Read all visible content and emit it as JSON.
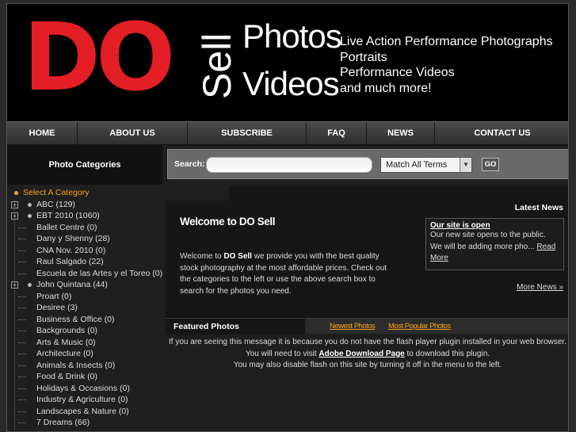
{
  "banner": {
    "logo_main": "DO",
    "logo_sell": "Sell",
    "logo_photos": "Photos",
    "logo_videos": "Videos",
    "tagline": [
      "Live Action Performance Photographs",
      "Portraits",
      "Performance Videos",
      "and much more!"
    ]
  },
  "colors": {
    "brand_red": "#e41e25",
    "accent_orange": "#f5a21d",
    "background": "#1e1e1e"
  },
  "nav": {
    "items": [
      "HOME",
      "ABOUT US",
      "SUBSCRIBE",
      "FAQ",
      "NEWS",
      "CONTACT US"
    ]
  },
  "sidebar": {
    "heading": "Photo Categories",
    "select_label": "Select A Category",
    "categories": [
      "ABC (129)",
      "EBT 2010 (1060)",
      "Ballet Centre (0)",
      "Dany y Shenny (28)",
      "CNA Nov. 2010 (0)",
      "Raul Salgado (22)",
      "Escuela de las Artes y el Toreo (0)",
      "John Quintana (44)",
      "Proart (0)",
      "Desiree (3)",
      "Business & Office (0)",
      "Backgrounds (0)",
      "Arts & Music (0)",
      "Architecture (0)",
      "Animals & Insects (0)",
      "Food & Drink (0)",
      "Holidays & Occasions (0)",
      "Industry & Agriculture (0)",
      "Landscapes & Nature (0)",
      "7 Dreams (66)"
    ]
  },
  "search": {
    "label": "Search:",
    "value": "",
    "match_option": "Match All Terms",
    "go_label": "GO"
  },
  "welcome": {
    "title": "Welcome to DO Sell",
    "text_prefix": "Welcome to ",
    "brand": "DO Sell",
    "text_body": " we provide you with the best quality stock photography at the most affordable prices. Check out the categories to the left or use the above search box to search for the photos you need."
  },
  "news": {
    "heading": "Latest News",
    "item_title": "Our site is open",
    "item_body": "Our new site opens to the public. We will be adding more pho... ",
    "read_more": "Read More",
    "more_news": "More News »"
  },
  "featured": {
    "label": "Featured Photos",
    "newest": "Newest Photos",
    "popular": "Most Popular Photos"
  },
  "flash": {
    "line1": "If you are seeing this message it is because you do not have the flash player plugin installed in your web browser.",
    "line2_prefix": "You will need to visit ",
    "line2_link": "Adobe Download Page",
    "line2_suffix": " to download this plugin.",
    "line3": "You may also disable flash on this site by turning it off in the menu to the left."
  }
}
